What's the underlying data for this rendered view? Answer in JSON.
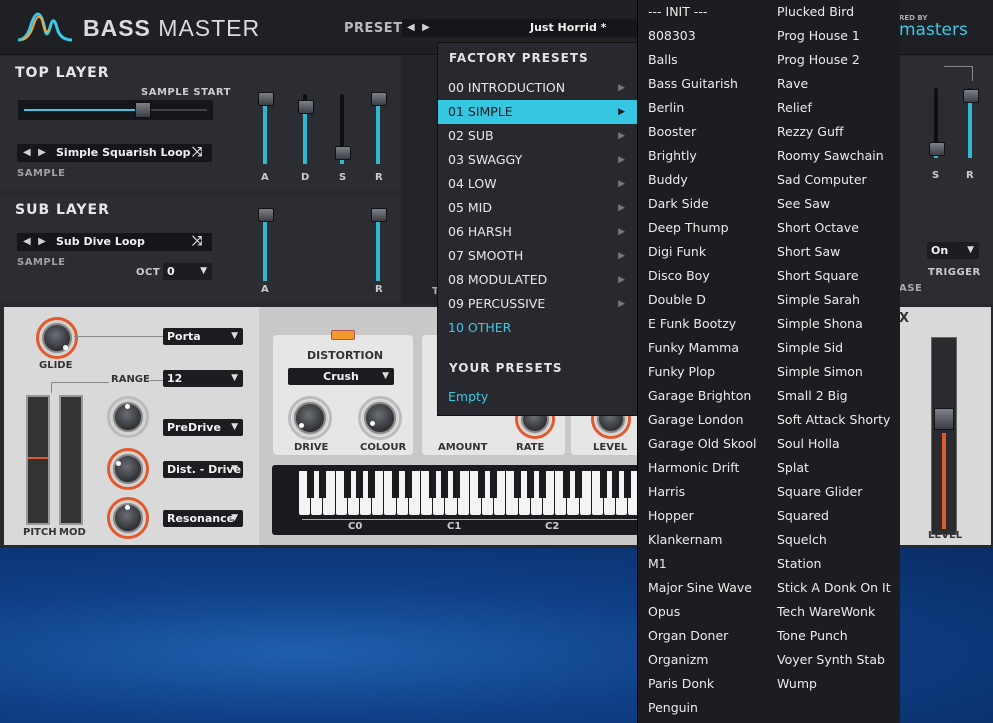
{
  "app": {
    "title_bold": "BASS",
    "title_rest": " MASTER",
    "preset_label": "PRESET",
    "preset_value": "Just Horrid *",
    "brand_partial": "RED BY",
    "brand_name": "masters"
  },
  "top_layer": {
    "title": "TOP LAYER",
    "sample_start_label": "SAMPLE START",
    "sample_start_value": 0.7,
    "sample_name": "Simple Squarish Loop",
    "sample_label": "SAMPLE",
    "adsr": [
      {
        "label": "A",
        "level": 0.9
      },
      {
        "label": "D",
        "level": 0.7
      },
      {
        "label": "S",
        "level": 0.1
      },
      {
        "label": "R",
        "level": 0.9
      }
    ]
  },
  "sub_layer": {
    "title": "SUB LAYER",
    "sample_name": "Sub Dive Loop",
    "sample_label": "SAMPLE",
    "oct_label": "OCT",
    "oct_value": "0",
    "ar": [
      {
        "label": "A",
        "level": 0.95
      },
      {
        "label": "R",
        "level": 0.95
      }
    ]
  },
  "right_layer": {
    "s_label": "S",
    "r_label": "R",
    "trigger_label": "TRIGGER",
    "trigger_value": "On",
    "release_partial": "ASE",
    "t_partial": "T"
  },
  "performance": {
    "glide_label": "GLIDE",
    "porta_value": "Porta",
    "range_label": "RANGE",
    "range_value": "12",
    "predrive_value": "PreDrive",
    "dist_drive_value": "Dist. - Drive",
    "resonance_value": "Resonance",
    "pitch_label": "PITCH",
    "mod_label": "MOD"
  },
  "distortion": {
    "title": "DISTORTION",
    "type_value": "Crush",
    "drive_label": "DRIVE",
    "colour_label": "COLOUR"
  },
  "fx": {
    "amount_label": "AMOUNT",
    "rate_label": "RATE",
    "level_label": "LEVEL",
    "x_partial": "X"
  },
  "output": {
    "level_label": "LEVEL"
  },
  "keyboard": {
    "octave_labels": [
      "C0",
      "C1",
      "C2"
    ]
  },
  "preset_menu": {
    "factory_title": "FACTORY PRESETS",
    "categories": [
      "00 INTRODUCTION",
      "01 SIMPLE",
      "02 SUB",
      "03 SWAGGY",
      "04 LOW",
      "05 MID",
      "06 HARSH",
      "07 SMOOTH",
      "08 MODULATED",
      "09 PERCUSSIVE",
      "10 OTHER"
    ],
    "selected_index": 1,
    "your_title": "YOUR PRESETS",
    "your_empty": "Empty"
  },
  "submenu": {
    "col1": [
      "--- INIT ---",
      "808303",
      "Balls",
      "Bass Guitarish",
      "Berlin",
      "Booster",
      "Brightly",
      "Buddy",
      "Dark Side",
      "Deep Thump",
      "Digi Funk",
      "Disco Boy",
      "Double D",
      "E Funk Bootzy",
      "Funky Mamma",
      "Funky Plop",
      "Garage Brighton",
      "Garage London",
      "Garage Old Skool",
      "Harmonic Drift",
      "Harris",
      "Hopper",
      "Klankernam",
      "M1",
      "Major Sine Wave",
      "Opus",
      "Organ Doner",
      "Organizm",
      "Paris Donk",
      "Penguin"
    ],
    "col2": [
      "Plucked Bird",
      "Prog House 1",
      "Prog House 2",
      "Rave",
      "Relief",
      "Rezzy Guff",
      "Roomy Sawchain",
      "Sad Computer",
      "See Saw",
      "Short Octave",
      "Short Saw",
      "Short Square",
      "Simple Sarah",
      "Simple Shona",
      "Simple Sid",
      "Simple Simon",
      "Small 2 Big",
      "Soft Attack Shorty",
      "Soul Holla",
      "Splat",
      "Square Glider",
      "Squared",
      "Squelch",
      "Station",
      "Stick A Donk On It",
      "Tech WareWonk",
      "Tone Punch",
      "Voyer Synth Stab",
      "Wump"
    ]
  },
  "colors": {
    "accent": "#35c6e2",
    "knob_ring": "#e25a2c"
  }
}
